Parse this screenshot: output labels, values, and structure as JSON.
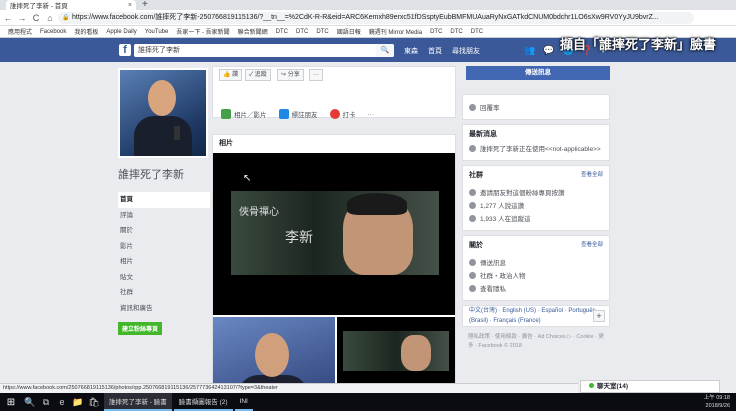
{
  "browser": {
    "tab_title": "誰摔死了李新 - 首頁",
    "tab_close": "×",
    "new_tab": "+",
    "url": "https://www.facebook.com/誰摔死了李新-250766819115136/?__tn__=%2CdK-R-R&eid=ARC6Kemxh89erxc51fDSsptyEubBMFMUAuaRyNxGATkdCNUM0bdchr1LO6sXw9RV0YyJU9bvrZ...",
    "back": "←",
    "forward": "→",
    "reload": "C",
    "home": "⌂",
    "lock": "🔒"
  },
  "bookmarks": [
    "應用程式",
    "Facebook",
    "我的看板",
    "Apple Daily",
    "YouTube",
    "吾家一下 - 吾家新聞",
    "聯合新聞網",
    "DTC",
    "DTC",
    "DTC",
    "國語日報",
    "鏡週刊 Mirror Media",
    "DTC",
    "DTC",
    "DTC"
  ],
  "fb": {
    "logo": "f",
    "search_value": "誰摔死了李新",
    "search_icon": "🔍",
    "nav": [
      "東森",
      "首頁",
      "尋找朋友"
    ],
    "icons": [
      "👥",
      "💬",
      "🌐",
      "❓",
      "▾"
    ]
  },
  "overlay_text": "擷自「誰摔死了李新」臉書",
  "left": {
    "page_name": "誰摔死了李新",
    "nav": [
      "首頁",
      "評論",
      "關於",
      "影片",
      "相片",
      "貼文",
      "社群",
      "資訊和廣告"
    ],
    "create_page": "建立粉絲專頁"
  },
  "action": {
    "buttons": [
      "👍 讚",
      "✓ 追蹤",
      "↪ 分享",
      "···"
    ],
    "cta": [
      "相片／影片",
      "標註朋友",
      "打卡",
      "···"
    ]
  },
  "photos": {
    "heading": "相片",
    "banner_calligraphy": "俠骨禪心",
    "banner_name": "李新",
    "cursor": "↖"
  },
  "right": {
    "message_button": "傳送訊息",
    "reply_text": "回覆率",
    "recent_title": "最新消息",
    "recent_text": "誰摔死了李新正在使用<<not-applicable>>",
    "community": {
      "title": "社群",
      "link": "查看全部",
      "rows": [
        "邀請朋友對這個粉絲專頁按讚",
        "1,277 人說這讚",
        "1,933 人在追蹤這"
      ]
    },
    "about": {
      "title": "關於",
      "link": "查看全部",
      "rows": [
        "傳送訊息",
        "社群・政治人物",
        "查看隱私"
      ]
    },
    "languages": "中文(台灣) · English (US) · Español · Português (Brasil) · Français (France)",
    "plus": "+",
    "footer": "隱私政策 · 使用條款 · 廣告 · Ad Choices ▷ · Cookie · 更多 · Facebook © 2018"
  },
  "status_url": "https://www.facebook.com/250766819115136/photos/rpp.250766819115136/257773642413107/?type=3&theater",
  "chat": {
    "label": "聊天室(14)"
  },
  "taskbar": {
    "start": "⊞",
    "icons": [
      "🔍",
      "⧉",
      "e",
      "📁",
      "🛍"
    ],
    "apps": [
      "誰摔死了李新 - 臉書",
      "臉書擷圖報告 (2)",
      "INI"
    ],
    "time": "上午 09:18",
    "date": "2018/9/26"
  }
}
